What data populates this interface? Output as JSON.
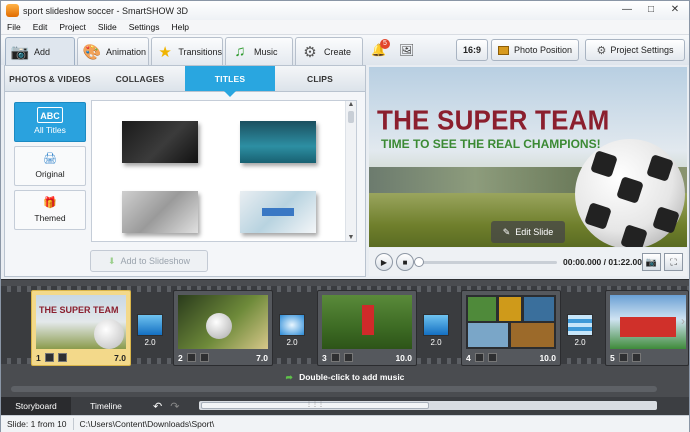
{
  "window": {
    "title": "sport slideshow soccer - SmartSHOW 3D"
  },
  "menu": [
    "File",
    "Edit",
    "Project",
    "Slide",
    "Settings",
    "Help"
  ],
  "toolbar": {
    "tabs": [
      "Add",
      "Animation",
      "Transitions",
      "Music",
      "Create"
    ],
    "notification_count": "5",
    "aspect_ratio": "16:9",
    "photo_position": "Photo Position",
    "project_settings": "Project Settings"
  },
  "left_panel": {
    "subtabs": [
      "PHOTOS & VIDEOS",
      "COLLAGES",
      "TITLES",
      "CLIPS"
    ],
    "categories": [
      {
        "icon_text": "ABC",
        "label": "All Titles"
      },
      {
        "icon_text": "",
        "label": "Original"
      },
      {
        "icon_text": "",
        "label": "Themed"
      }
    ],
    "add_button": "Add to Slideshow"
  },
  "preview": {
    "title": "THE SUPER TEAM",
    "subtitle": "TIME TO SEE THE REAL CHAMPIONS!",
    "edit_button": "Edit Slide",
    "timecode": "00:00.000 / 01:22.000"
  },
  "storyboard": {
    "slides": [
      {
        "number": "1",
        "duration": "7.0"
      },
      {
        "number": "2",
        "duration": "7.0"
      },
      {
        "number": "3",
        "duration": "10.0"
      },
      {
        "number": "4",
        "duration": "10.0"
      },
      {
        "number": "5",
        "duration": ""
      }
    ],
    "transitions": [
      "2.0",
      "2.0",
      "2.0",
      "2.0",
      "2.0"
    ],
    "music_hint": "Double-click to add music",
    "tabs": [
      "Storyboard",
      "Timeline"
    ]
  },
  "status": {
    "slide": "Slide: 1 from 10",
    "path": "C:\\Users\\Content\\Downloads\\Sport\\"
  }
}
